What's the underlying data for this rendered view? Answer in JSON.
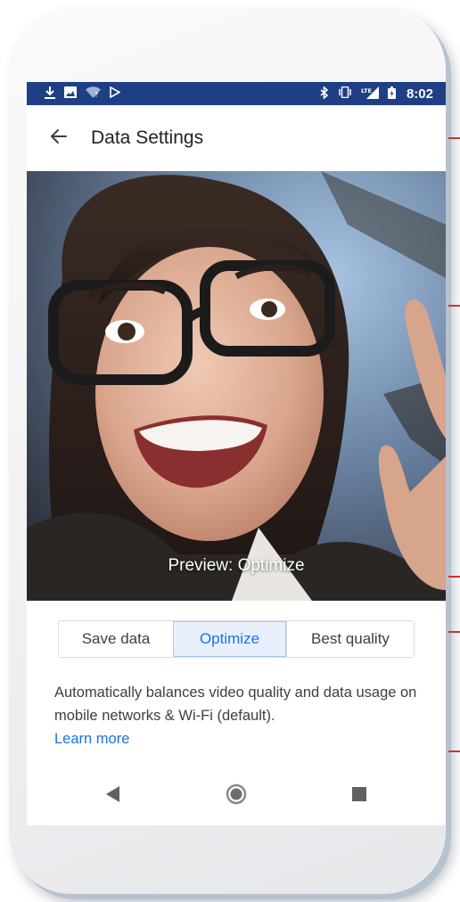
{
  "status_bar": {
    "time": "8:02",
    "network_label": "LTE",
    "left_icons": [
      "download-icon",
      "image-icon",
      "wifi-icon",
      "play-store-icon"
    ],
    "right_icons": [
      "bluetooth-icon",
      "vibrate-icon",
      "lte-signal-icon",
      "battery-icon"
    ],
    "background": "#1f3f85"
  },
  "app_bar": {
    "title": "Data Settings",
    "back_icon": "arrow-back-icon"
  },
  "preview": {
    "caption": "Preview: Optimize"
  },
  "quality_options": [
    {
      "label": "Save data",
      "selected": false
    },
    {
      "label": "Optimize",
      "selected": true
    },
    {
      "label": "Best quality",
      "selected": false
    }
  ],
  "description": {
    "text": "Automatically balances video quality and data usage on mobile networks & Wi-Fi (default).",
    "link": "Learn more"
  },
  "nav_bar": {
    "icons": [
      "back-triangle-icon",
      "home-circle-icon",
      "recents-square-icon"
    ]
  },
  "colors": {
    "accent": "#1a73e8",
    "selected_bg": "#e8f0fe",
    "callout": "#d32f2f"
  }
}
